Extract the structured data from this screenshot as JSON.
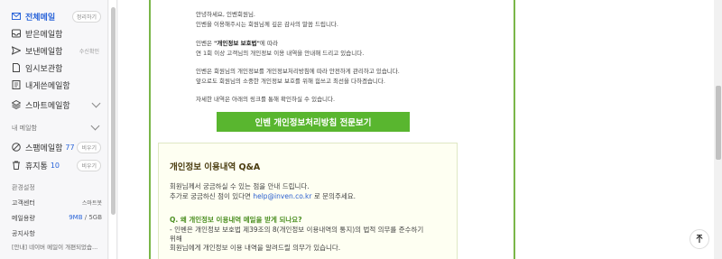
{
  "sidebar": {
    "folders": [
      {
        "label": "전체메일",
        "icon": "mail-icon",
        "action": "정리하기"
      },
      {
        "label": "받은메일함",
        "icon": "inbox-icon"
      },
      {
        "label": "보낸메일함",
        "icon": "send-icon",
        "tag": "수신확인"
      },
      {
        "label": "임시보관함",
        "icon": "draft-icon"
      },
      {
        "label": "내게쓴메일함",
        "icon": "note-icon"
      },
      {
        "label": "스마트메일함",
        "icon": "layers-icon"
      }
    ],
    "my_folder_label": "내 메일함",
    "spam": {
      "label": "스팸메일함",
      "count": "77",
      "action": "비우기"
    },
    "trash": {
      "label": "휴지통",
      "count": "10",
      "action": "비우기"
    },
    "settings_label": "환경설정",
    "support": {
      "label": "고객센터",
      "right": "스마트봇"
    },
    "capacity": {
      "label": "메일용량",
      "used": "9MB",
      "sep": " / ",
      "total": "5GB"
    },
    "notice": {
      "label": "공지사항",
      "text": "[안내] 네이버 메일이 개편되었습..."
    }
  },
  "mail": {
    "greeting": "안녕하세요, 인벤회원님.",
    "thanks": "인벤을 이용해주시는 회원님께 깊은 감사의 말씀 드립니다.",
    "law_prefix": "인벤은 ",
    "law_name": "\"개인정보 보호법\"",
    "law_suffix": "에 따라",
    "annual": "연 1회 이상 고객님의 개인정보 이용 내역을 안내해 드리고 있습니다.",
    "manage1": "인벤은 회원님의 개인정보를 개인정보처리방침에 따라 안전하게 관리하고 있습니다.",
    "manage2": "앞으로도 회원님의 소중한 개인정보 보호를 위해 힘쓰고 최선을 다하겠습니다.",
    "detail": "자세한 내역은 아래의 링크를 통해 확인하실 수 있습니다.",
    "button": "인벤 개인정보처리방침 전문보기",
    "qa": {
      "title": "개인정보 이용내역 Q&A",
      "line1": "회원님께서 궁금하실 수 있는 점을 안내 드립니다.",
      "line2_prefix": "추가로 궁금하신 점이 있다면 ",
      "email": "help@inven.co.kr",
      "line2_suffix": " 로 문의주세요.",
      "question": "Q. 왜 개인정보 이용내역 메일을 받게 되나요?",
      "answer1": "- 인벤은 개인정보 보호법 제39조의 8(개인정보 이용내역의 통지)의 법적 의무를 준수하기",
      "answer2": "위해",
      "answer3": "회원님에게 개인정보 이용 내역을 알려드릴 의무가 있습니다."
    }
  },
  "colors": {
    "accent": "#2b65d9",
    "green": "#59b62f",
    "frame": "#7ab648"
  },
  "scroll_top_icon": "arrow-up-icon"
}
